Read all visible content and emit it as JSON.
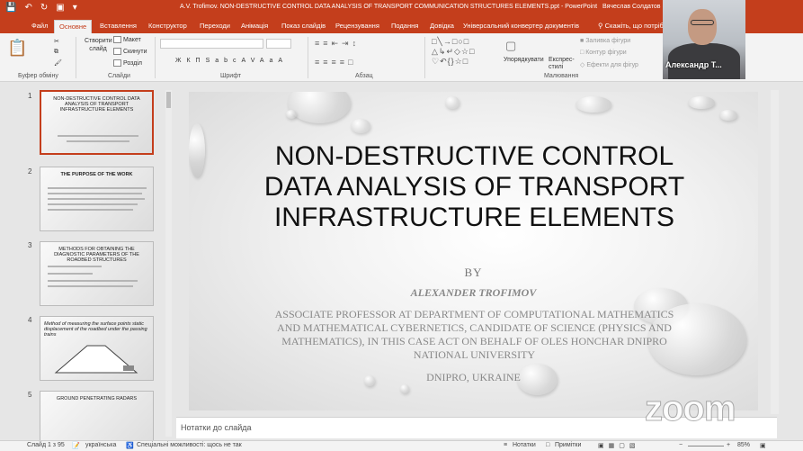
{
  "window": {
    "title": "A.V. Trofimov. NON-DESTRUCTIVE CONTROL DATA ANALYSIS OF TRANSPORT COMMUNICATION STRUCTURES ELEMENTS.ppt - PowerPoint",
    "user": "Вячеслав Солдатов",
    "accent": "#c43e1c"
  },
  "tabs": [
    "Файл",
    "Основне",
    "Вставлення",
    "Конструктор",
    "Переходи",
    "Анімація",
    "Показ слайдів",
    "Рецензування",
    "Подання",
    "Довідка",
    "Універсальний конвертер документів"
  ],
  "tab_search": "Скажіть, що потрібно...",
  "ribbon": {
    "clipboard": "Буфер обміну",
    "slides": "Слайди",
    "new_slide": "Створити слайд",
    "layout": "Макет",
    "reset": "Скинути",
    "section": "Розділ",
    "font": "Шрифт",
    "paragraph": "Абзац",
    "drawing": "Малювання",
    "arrange": "Упорядкувати",
    "quick_styles": "Експрес-стилі",
    "fill": "Заливка фігури",
    "outline": "Контур фігури",
    "effects": "Ефекти для фігур",
    "font_btns": [
      "Ж",
      "К",
      "П",
      "S",
      "abc",
      "AV",
      "Aa",
      "A"
    ]
  },
  "thumbnails": [
    {
      "num": "1",
      "title": "NON-DESTRUCTIVE CONTROL DATA ANALYSIS OF TRANSPORT INFRASTRUCTURE ELEMENTS"
    },
    {
      "num": "2",
      "title": "THE PURPOSE OF THE WORK"
    },
    {
      "num": "3",
      "title": "METHODS FOR OBTAINING THE DIAGNOSTIC PARAMETERS OF THE ROADBED STRUCTURES"
    },
    {
      "num": "4",
      "title": "Method of measuring the surface points static displacement of the roadbed under the passing trains"
    },
    {
      "num": "5",
      "title": "GROUND PENETRATING RADARS"
    }
  ],
  "slide": {
    "title": "NON-DESTRUCTIVE CONTROL DATA ANALYSIS OF TRANSPORT INFRASTRUCTURE ELEMENTS",
    "by": "BY",
    "author": "ALEXANDER TROFIMOV",
    "description": "ASSOCIATE PROFESSOR AT DEPARTMENT OF COMPUTATIONAL MATHEMATICS AND MATHEMATICAL CYBERNETICS, CANDIDATE OF SCIENCE (PHYSICS AND MATHEMATICS), IN THIS CASE ACT ON BEHALF OF OLES HONCHAR DNIPRO NATIONAL UNIVERSITY",
    "location": "DNIPRO, UKRAINE"
  },
  "notes_placeholder": "Нотатки до слайда",
  "status": {
    "slide_counter": "Слайд 1 з 95",
    "language": "українська",
    "accessibility": "Спеціальні можливості: щось не так",
    "notes": "Нотатки",
    "comments": "Примітки",
    "zoom": "85%"
  },
  "webcam": {
    "name": "Александр Т..."
  },
  "watermark": "zoom"
}
